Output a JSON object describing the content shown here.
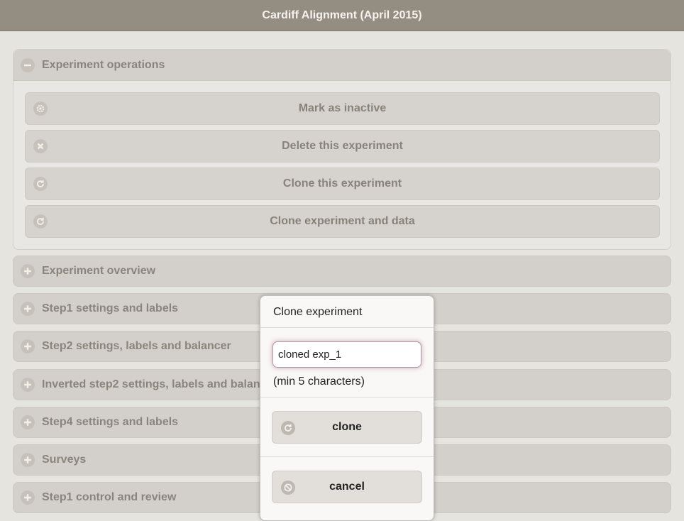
{
  "header": {
    "title": "Cardiff Alignment (April 2015)"
  },
  "operations": {
    "label": "Experiment operations",
    "icon": "minus-icon",
    "buttons": [
      {
        "label": "Mark as inactive",
        "icon": "gear-icon"
      },
      {
        "label": "Delete this experiment",
        "icon": "delete-icon"
      },
      {
        "label": "Clone this experiment",
        "icon": "refresh-icon"
      },
      {
        "label": "Clone experiment and data",
        "icon": "refresh-icon"
      }
    ]
  },
  "sections": [
    {
      "label": "Experiment overview",
      "icon": "plus-icon"
    },
    {
      "label": "Step1 settings and labels",
      "icon": "plus-icon"
    },
    {
      "label": "Step2 settings, labels and balancer",
      "icon": "plus-icon"
    },
    {
      "label": "Inverted step2 settings, labels and balan",
      "icon": "plus-icon"
    },
    {
      "label": "Step4 settings and labels",
      "icon": "plus-icon"
    },
    {
      "label": "Surveys",
      "icon": "plus-icon"
    },
    {
      "label": "Step1 control and review",
      "icon": "plus-icon"
    }
  ],
  "dialog": {
    "title": "Clone experiment",
    "input_value": "cloned exp_1",
    "hint": "(min 5 characters)",
    "clone_label": "clone",
    "clone_icon": "refresh-icon",
    "cancel_label": "cancel",
    "cancel_icon": "cancel-icon"
  },
  "colors": {
    "header_bg": "#948d82",
    "page_bg": "#e6e4df",
    "section_bg": "#d3d0cb",
    "focus_glow": "#c9a4b2"
  }
}
